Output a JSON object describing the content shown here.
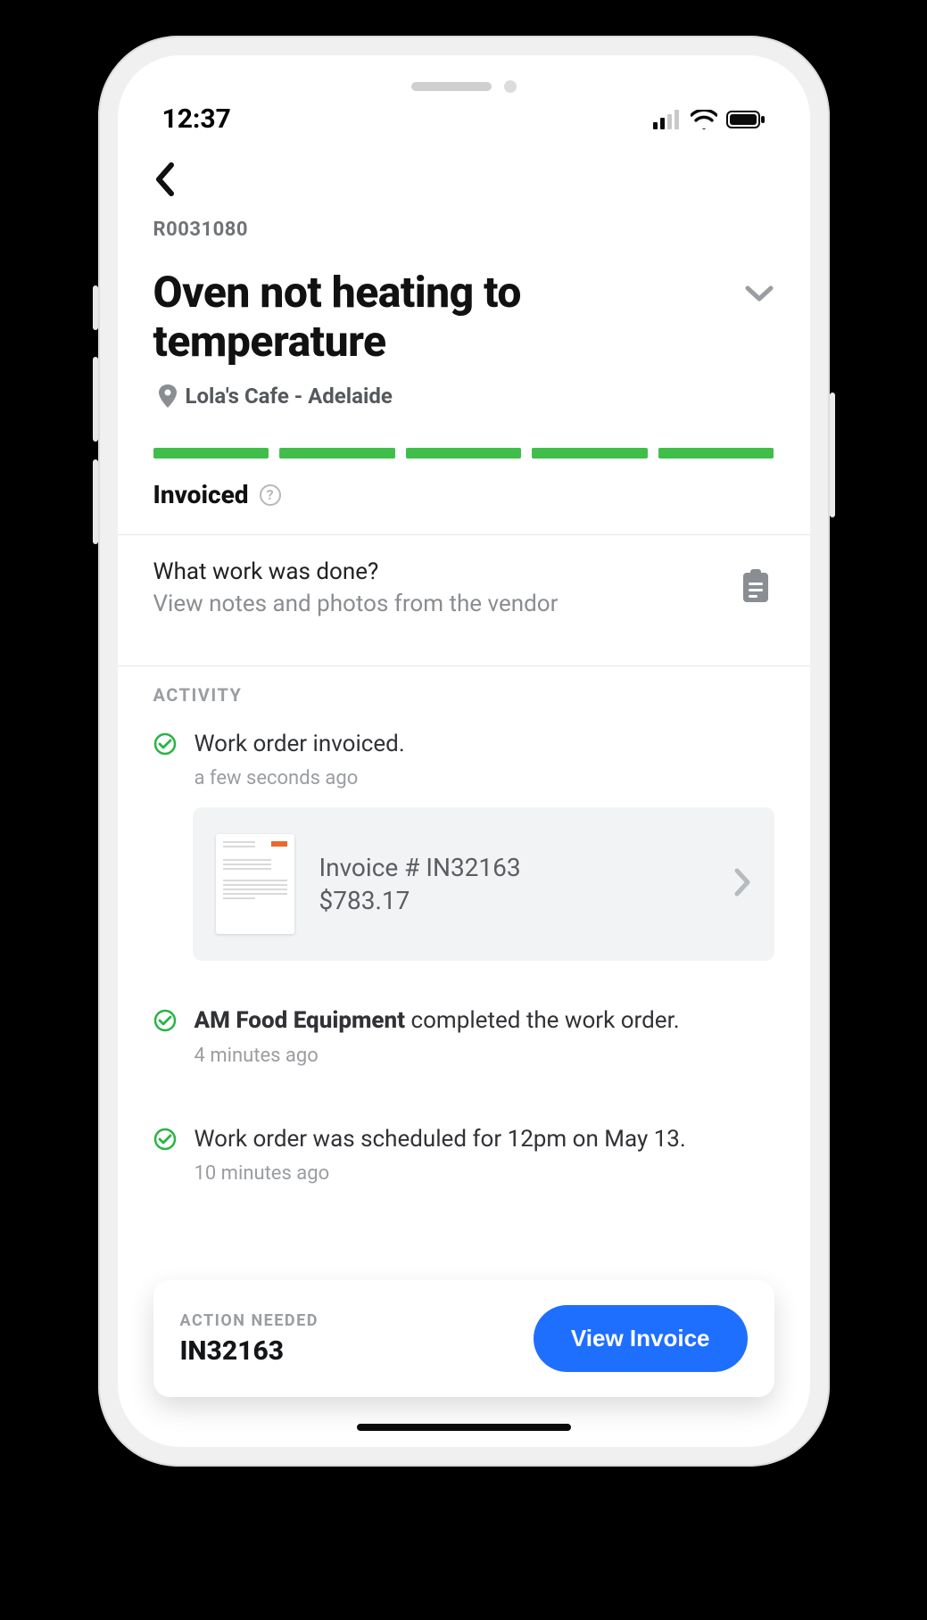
{
  "status_bar": {
    "time": "12:37"
  },
  "order": {
    "id": "R0031080",
    "title": "Oven not heating to temperature",
    "location": "Lola's Cafe - Adelaide",
    "status": "Invoiced"
  },
  "work_summary": {
    "title": "What work was done?",
    "subtitle": "View notes and photos from the vendor"
  },
  "section_activity_label": "ACTIVITY",
  "activity": [
    {
      "text_prefix": "",
      "text_bold": "",
      "text_suffix": "Work order invoiced.",
      "time": "a few seconds ago"
    },
    {
      "text_prefix": "",
      "text_bold": "AM Food Equipment",
      "text_suffix": " completed the work order.",
      "time": "4 minutes ago"
    },
    {
      "text_prefix": "",
      "text_bold": "",
      "text_suffix": "Work order was scheduled for 12pm on May 13.",
      "time": "10 minutes ago"
    }
  ],
  "invoice": {
    "number_label": "Invoice # IN32163",
    "amount": "$783.17"
  },
  "action": {
    "label": "ACTION NEEDED",
    "value": "IN32163",
    "button": "View Invoice"
  }
}
